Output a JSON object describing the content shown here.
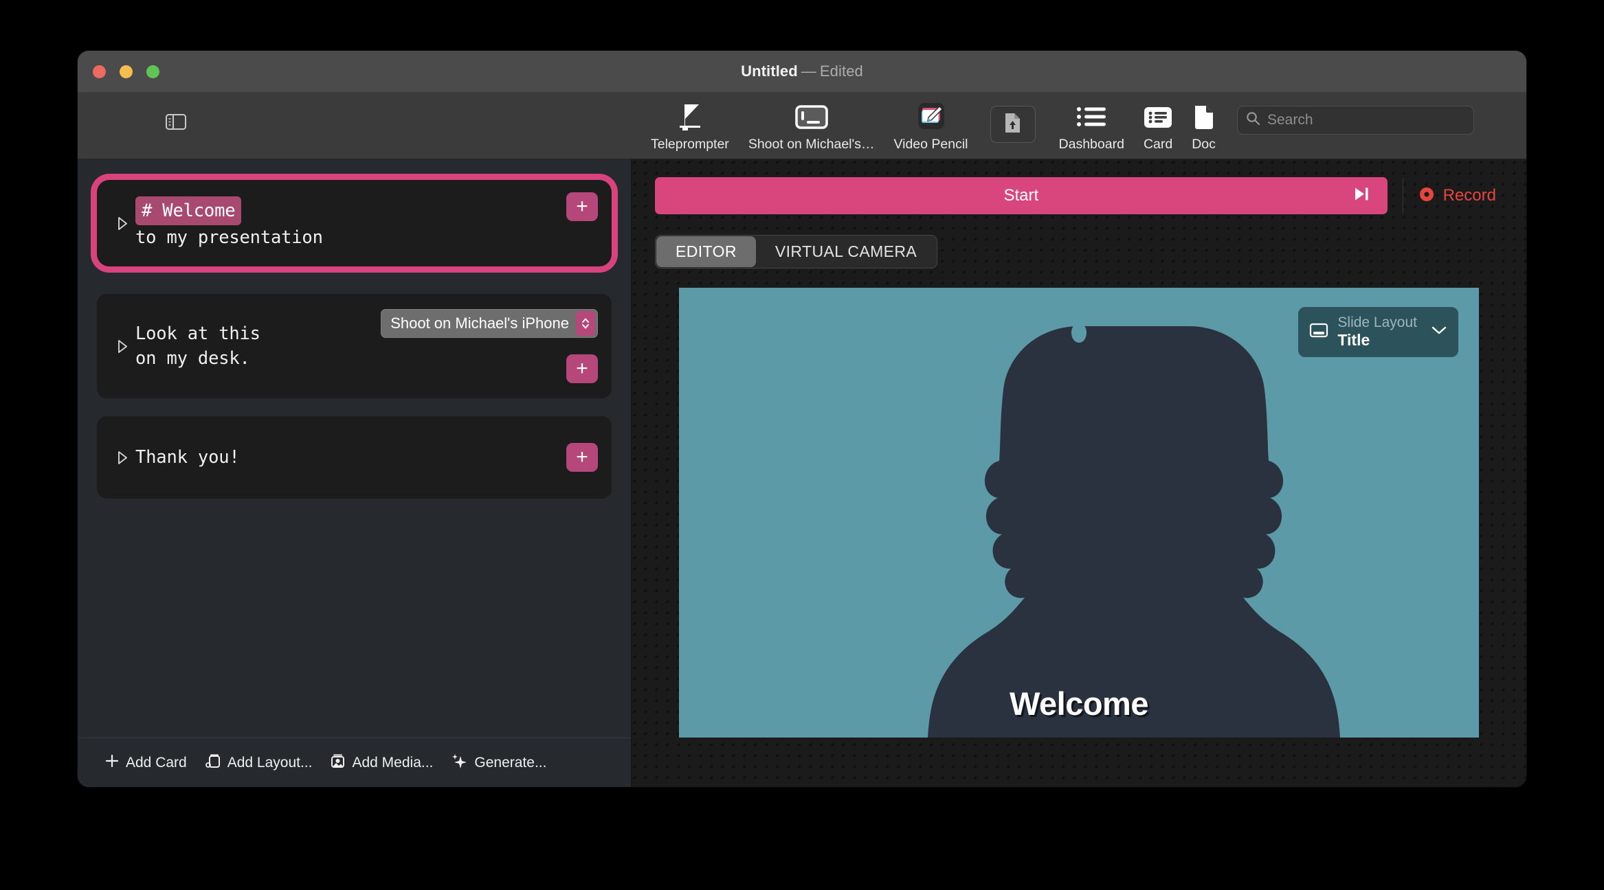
{
  "window": {
    "title_name": "Untitled",
    "title_dash": "—",
    "title_state": "Edited",
    "traffic_lights": [
      "close-red",
      "minimize-yellow",
      "zoom-green"
    ]
  },
  "toolbar": {
    "sidebar_toggle_icon": "sidebar-toggle-icon",
    "items": [
      {
        "label": "Teleprompter",
        "icon": "teleprompter-icon"
      },
      {
        "label": "Shoot on Michael's…",
        "icon": "screen-share-icon"
      },
      {
        "label": "Video Pencil",
        "icon": "video-pencil-icon"
      }
    ],
    "export_icon": "document-upload-icon",
    "right_items": [
      {
        "label": "Dashboard",
        "icon": "list-bullets-icon"
      },
      {
        "label": "Card",
        "icon": "card-list-icon"
      },
      {
        "label": "Doc",
        "icon": "document-icon"
      }
    ],
    "search": {
      "placeholder": "Search",
      "value": "",
      "icon": "search-icon"
    }
  },
  "sidebar": {
    "cards": [
      {
        "selected": true,
        "heading": "# Welcome",
        "body": "to my presentation",
        "add_label": "+",
        "disclosure_icon": "triangle-right-icon"
      },
      {
        "selected": false,
        "line1": "Look at this",
        "line2": "on my desk.",
        "popup_value": "Shoot on Michael's iPhone",
        "add_label": "+",
        "disclosure_icon": "triangle-right-icon"
      },
      {
        "selected": false,
        "line1": "Thank you!",
        "add_label": "+",
        "disclosure_icon": "triangle-right-icon"
      }
    ],
    "bottom_bar": [
      {
        "label": "Add Card",
        "icon": "plus-icon"
      },
      {
        "label": "Add Layout...",
        "icon": "layout-stack-icon"
      },
      {
        "label": "Add Media...",
        "icon": "media-image-icon"
      },
      {
        "label": "Generate...",
        "icon": "sparkles-icon"
      }
    ]
  },
  "main": {
    "start_button": {
      "label": "Start",
      "next_icon": "skip-forward-icon"
    },
    "record_button": {
      "label": "Record",
      "icon": "record-circle-icon"
    },
    "tabs": [
      {
        "label": "EDITOR",
        "active": true
      },
      {
        "label": "VIRTUAL CAMERA",
        "active": false
      }
    ],
    "slide": {
      "title": "Welcome",
      "background_color": "#5d9aa8",
      "silhouette_color": "#2b323f",
      "layout_chip": {
        "icon": "slide-layout-icon",
        "sub_label": "Slide Layout",
        "value": "Title",
        "chevron_icon": "chevron-down-icon"
      }
    }
  },
  "colors": {
    "accent_pink": "#d9457d",
    "accent_pink_muted": "#b5477a",
    "record_red": "#e8453c",
    "slide_teal": "#5d9aa8",
    "chip_teal": "#2c535b"
  }
}
